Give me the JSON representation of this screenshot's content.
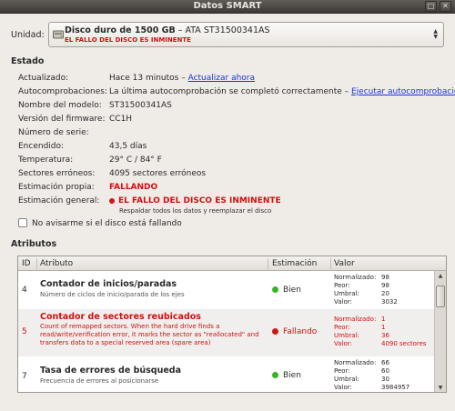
{
  "window": {
    "title": "Datos SMART"
  },
  "drive": {
    "label": "Unidad:",
    "name": "Disco duro de 1500 GB",
    "model_suffix": " – ATA ST31500341AS",
    "warning": "EL FALLO DEL DISCO ES INMINENTE"
  },
  "estado": {
    "heading": "Estado",
    "rows": [
      {
        "label": "Actualizado:",
        "value": "Hace 13 minutos – ",
        "link": "Actualizar ahora"
      },
      {
        "label": "Autocomprobaciones:",
        "value": "La última autocomprobación se completó correctamente – ",
        "link": "Ejecutar autocomprobación"
      },
      {
        "label": "Nombre del modelo:",
        "value": "ST31500341AS"
      },
      {
        "label": "Versión del firmware:",
        "value": "CC1H"
      },
      {
        "label": "Número de serie:",
        "value": ""
      },
      {
        "label": "Encendido:",
        "value": "43,5 días"
      },
      {
        "label": "Temperatura:",
        "value": "29° C / 84° F"
      },
      {
        "label": "Sectores erróneos:",
        "value": "4095 sectores erróneos"
      },
      {
        "label": "Estimación propia:",
        "value": "FALLANDO"
      },
      {
        "label": "Estimación general:",
        "value": "EL FALLO DEL DISCO ES INMINENTE",
        "note": "Respaldar todos los datos y reemplazar el disco"
      }
    ],
    "checkbox_label": "No avisarme si el disco está fallando"
  },
  "atributos": {
    "heading": "Atributos",
    "columns": [
      "ID",
      "Atributo",
      "Estimación",
      "Valor"
    ],
    "rows": [
      {
        "id": "4",
        "name": "Contador de inicios/paradas",
        "desc": "Número de ciclos de inicio/parada de los ejes",
        "estimacion": "Bien",
        "status": "good",
        "values": [
          [
            "Normalizado:",
            "98"
          ],
          [
            "Peor:",
            "98"
          ],
          [
            "Umbral:",
            "20"
          ],
          [
            "Valor:",
            "3032"
          ]
        ]
      },
      {
        "id": "5",
        "name": "Contador de sectores reubicados",
        "desc": "Count of remapped sectors. When the hard drive finds a read/write/verification error, it marks the sector as \"reallocated\" and transfers data to a special reserved area (spare area)",
        "estimacion": "Fallando",
        "status": "bad",
        "values": [
          [
            "Normalizado:",
            "1"
          ],
          [
            "Peor:",
            "1"
          ],
          [
            "Umbral:",
            "36"
          ],
          [
            "Valor:",
            "4090 sectores"
          ]
        ]
      },
      {
        "id": "7",
        "name": "Tasa de errores de búsqueda",
        "desc": "Frecuencia de errores al posicionarse",
        "estimacion": "Bien",
        "status": "good",
        "values": [
          [
            "Normalizado:",
            "66"
          ],
          [
            "Peor:",
            "60"
          ],
          [
            "Umbral:",
            "30"
          ],
          [
            "Valor:",
            "3984957"
          ]
        ]
      }
    ]
  },
  "colors": {
    "failing": "#d01010",
    "good": "#36b523",
    "link": "#1a36d8"
  }
}
